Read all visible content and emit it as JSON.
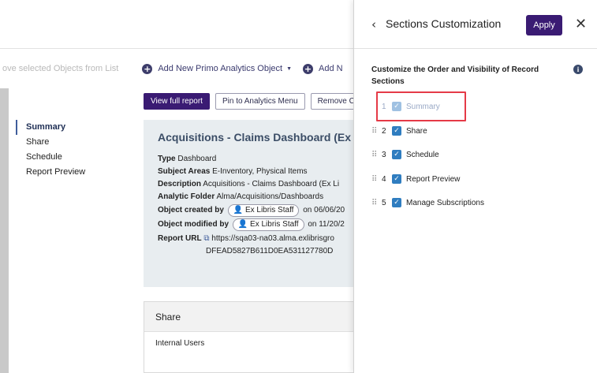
{
  "toolbar": {
    "remove_text": "ove selected Objects from List",
    "add_primo": "Add New Primo Analytics Object",
    "add_truncated": "Add N"
  },
  "nav": {
    "items": [
      "Summary",
      "Share",
      "Schedule",
      "Report Preview"
    ]
  },
  "actions": {
    "view_full_report": "View full report",
    "pin_to_menu": "Pin to Analytics Menu",
    "remove": "Remove C"
  },
  "summary": {
    "title": "Acquisitions - Claims Dashboard (Ex Lib",
    "type_label": "Type",
    "type_value": "Dashboard",
    "subject_label": "Subject Areas",
    "subject_value": "E-Inventory, Physical Items",
    "description_label": "Description",
    "description_value": "Acquisitions - Claims Dashboard (Ex Li",
    "folder_label": "Analytic Folder",
    "folder_value": "Alma/Acquisitions/Dashboards",
    "created_label": "Object created by",
    "created_user": "Ex Libris Staff",
    "created_date": "on 06/06/20",
    "modified_label": "Object modified by",
    "modified_user": "Ex Libris Staff",
    "modified_date": "on 11/20/2",
    "url_label": "Report URL",
    "url_value": "https://sqa03-na03.alma.exlibrisgro",
    "url_value_2": "DFEAD5827B611D0EA531127780D"
  },
  "share": {
    "title": "Share",
    "internal_users": "Internal Users"
  },
  "panel": {
    "title": "Sections Customization",
    "apply": "Apply",
    "subtitle": "Customize the Order and Visibility of Record Sections",
    "sections": [
      {
        "num": "1",
        "label": "Summary",
        "checked": true,
        "locked": true
      },
      {
        "num": "2",
        "label": "Share",
        "checked": true,
        "locked": false
      },
      {
        "num": "3",
        "label": "Schedule",
        "checked": true,
        "locked": false
      },
      {
        "num": "4",
        "label": "Report Preview",
        "checked": true,
        "locked": false
      },
      {
        "num": "5",
        "label": "Manage Subscriptions",
        "checked": true,
        "locked": false
      }
    ]
  },
  "colors": {
    "accent": "#3a1b73",
    "checkbox": "#2f7dc0",
    "highlight": "#e53a47",
    "summary_bg": "#e8edf0"
  },
  "icons": {
    "back": "chevron-left-icon",
    "close": "close-icon",
    "info": "info-icon",
    "user": "user-icon",
    "copy": "copy-icon",
    "drag": "drag-handle-icon",
    "add": "plus-circle-icon"
  }
}
